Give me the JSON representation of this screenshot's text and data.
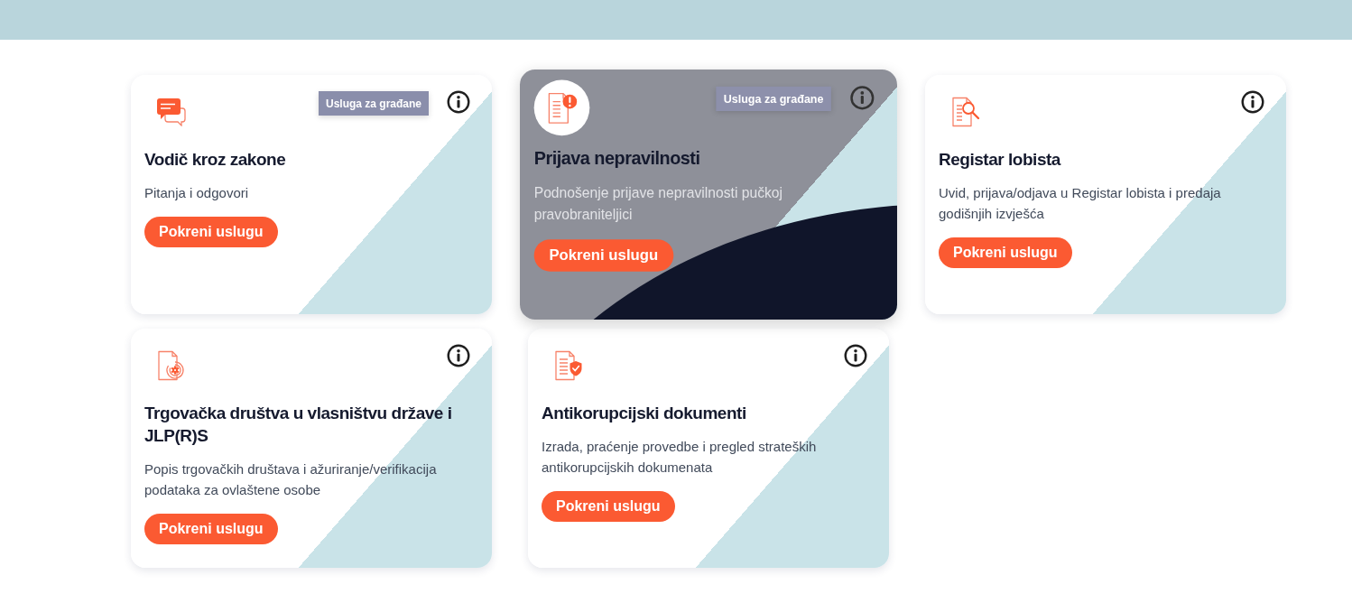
{
  "services": [
    {
      "title": "Vodič kroz zakone",
      "description": "Pitanja i odgovori",
      "badge": "Usluga za građane",
      "button": "Pokreni uslugu",
      "hovered": false
    },
    {
      "title": "Prijava nepravilnosti",
      "description": "Podnošenje prijave nepravilnosti pučkoj pravobraniteljici",
      "badge": "Usluga za građane",
      "button": "Pokreni uslugu",
      "hovered": true
    },
    {
      "title": "Registar lobista",
      "description": "Uvid, prijava/odjava u Registar lobista i predaja godišnjih izvješća",
      "button": "Pokreni uslugu",
      "hovered": false
    },
    {
      "title": "Trgovačka društva u vlasništvu države i JLP(R)S",
      "description": "Popis trgovačkih društava i ažuriranje/verifikacija podataka za ovlaštene osobe",
      "button": "Pokreni uslugu",
      "hovered": false
    },
    {
      "title": "Antikorupcijski dokumenti",
      "description": "Izrada, praćenje provedbe i pregled strateških antikorupcijskih dokumenata",
      "button": "Pokreni uslugu",
      "hovered": false
    }
  ]
}
